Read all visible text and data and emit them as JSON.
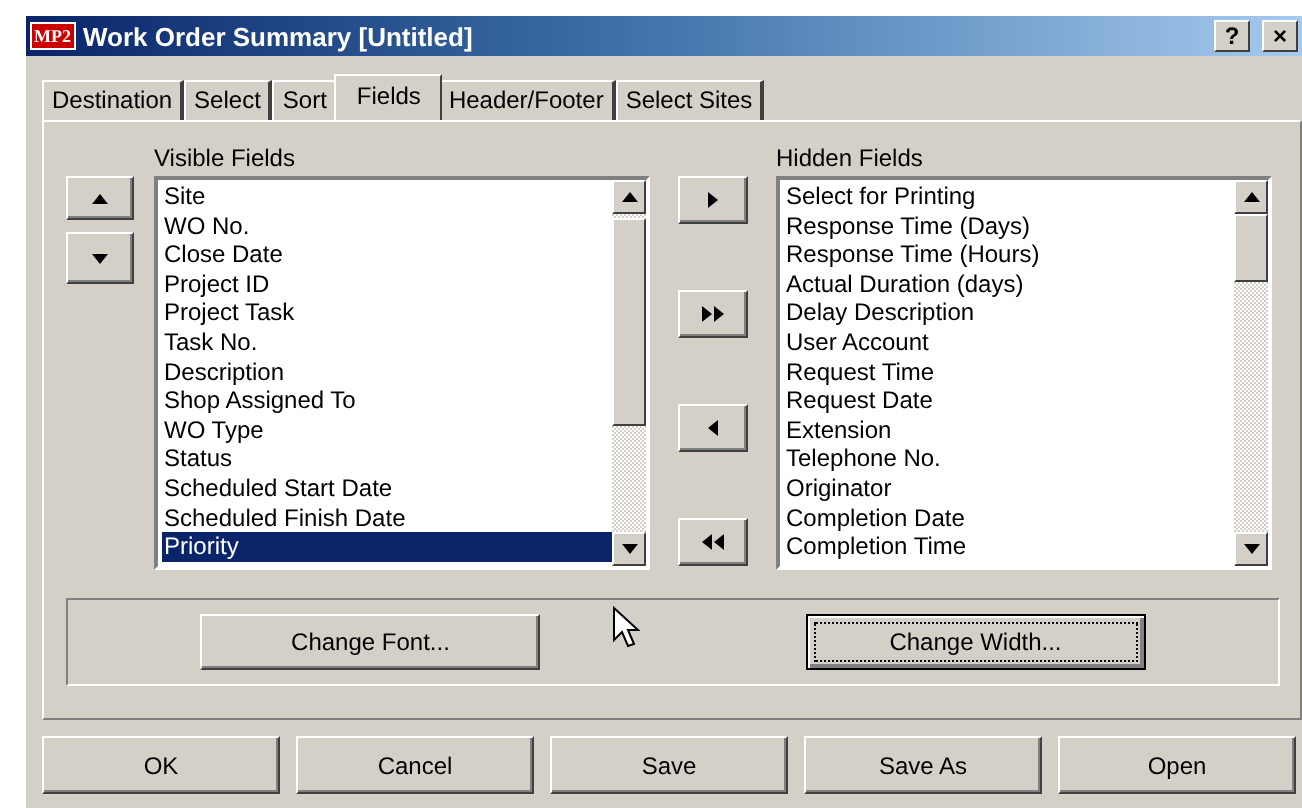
{
  "window": {
    "title": "Work Order Summary [Untitled]",
    "logo": "MP2",
    "buttons": [
      "?",
      "×"
    ]
  },
  "tabs": [
    {
      "label": "Destination",
      "selected": false
    },
    {
      "label": "Select",
      "selected": false
    },
    {
      "label": "Sort",
      "selected": false
    },
    {
      "label": "Fields",
      "selected": true
    },
    {
      "label": "Header/Footer",
      "selected": false
    },
    {
      "label": "Select Sites",
      "selected": false
    }
  ],
  "visible_fields": {
    "label": "Visible Fields",
    "items": [
      {
        "text": "Site",
        "selected": false
      },
      {
        "text": "WO No.",
        "selected": false
      },
      {
        "text": "Close Date",
        "selected": false
      },
      {
        "text": "Project ID",
        "selected": false
      },
      {
        "text": "Project Task",
        "selected": false
      },
      {
        "text": "Task No.",
        "selected": false
      },
      {
        "text": "Description",
        "selected": false
      },
      {
        "text": "Shop Assigned To",
        "selected": false
      },
      {
        "text": "WO Type",
        "selected": false
      },
      {
        "text": "Status",
        "selected": false
      },
      {
        "text": "Scheduled Start Date",
        "selected": false
      },
      {
        "text": "Scheduled Finish Date",
        "selected": false
      },
      {
        "text": "Priority",
        "selected": true
      }
    ]
  },
  "hidden_fields": {
    "label": "Hidden Fields",
    "items": [
      {
        "text": "Select for Printing",
        "selected": false
      },
      {
        "text": "Response Time (Days)",
        "selected": false
      },
      {
        "text": "Response Time (Hours)",
        "selected": false
      },
      {
        "text": "Actual Duration (days)",
        "selected": false
      },
      {
        "text": "Delay Description",
        "selected": false
      },
      {
        "text": "User Account",
        "selected": false
      },
      {
        "text": "Request Time",
        "selected": false
      },
      {
        "text": "Request Date",
        "selected": false
      },
      {
        "text": "Extension",
        "selected": false
      },
      {
        "text": "Telephone No.",
        "selected": false
      },
      {
        "text": "Originator",
        "selected": false
      },
      {
        "text": "Completion Date",
        "selected": false
      },
      {
        "text": "Completion Time",
        "selected": false
      }
    ]
  },
  "move_buttons": [
    {
      "kind": "up"
    },
    {
      "kind": "down"
    }
  ],
  "transfer_buttons": [
    {
      "kind": "right"
    },
    {
      "kind": "all-right"
    },
    {
      "kind": "left"
    },
    {
      "kind": "all-left"
    }
  ],
  "format_buttons": [
    {
      "label": "Change Font...",
      "focused": false
    },
    {
      "label": "Change Width...",
      "focused": true
    }
  ],
  "footer_buttons": [
    "OK",
    "Cancel",
    "Save",
    "Save As",
    "Open"
  ]
}
